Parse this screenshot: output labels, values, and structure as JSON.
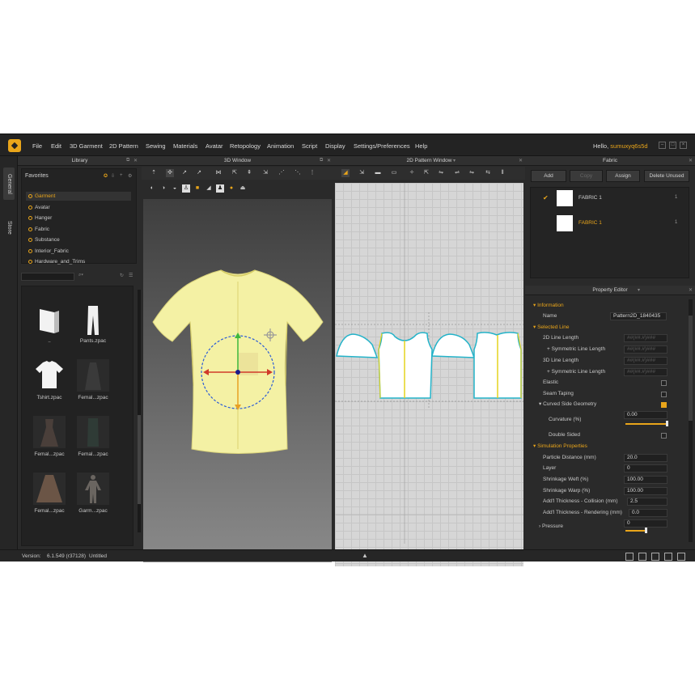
{
  "menu": [
    "File",
    "Edit",
    "3D Garment",
    "2D Pattern",
    "Sewing",
    "Materials",
    "Avatar",
    "Retopology",
    "Animation",
    "Script",
    "Display",
    "Settings/Preferences",
    "Help"
  ],
  "greeting": {
    "prefix": "Hello,",
    "user": "sumuxyq6s5d"
  },
  "window_controls": [
    "minimize",
    "restore",
    "close"
  ],
  "side_tabs": [
    "General",
    "Store"
  ],
  "library": {
    "title": "Library",
    "favorites_title": "Favorites",
    "favorites": [
      "Garment",
      "Avatar",
      "Hanger",
      "Fabric",
      "Substance",
      "Interior_Fabric",
      "Hardware_and_Trims"
    ],
    "items": [
      {
        "label": "..",
        "icon": "folder-up-icon"
      },
      {
        "label": "Pants.zpac",
        "icon": "pants-icon"
      },
      {
        "label": "Tshirt.zpac",
        "icon": "tshirt-icon"
      },
      {
        "label": "Femal...zpac",
        "icon": "dress-icon"
      },
      {
        "label": "Femal...zpac",
        "icon": "dress-icon"
      },
      {
        "label": "Femal...zpac",
        "icon": "dress-icon"
      },
      {
        "label": "Femal...zpac",
        "icon": "skirt-icon"
      },
      {
        "label": "Garm...zpac",
        "icon": "avatar-icon"
      }
    ]
  },
  "window3d": {
    "title": "3D Window"
  },
  "window2d": {
    "title": "2D Pattern Window"
  },
  "fabric": {
    "title": "Fabric",
    "buttons": [
      "Add",
      "Copy",
      "Assign",
      "Delete Unused"
    ],
    "items": [
      {
        "name": "FABRIC 1",
        "count": "1"
      },
      {
        "name": "FABRIC 1",
        "count": "1"
      }
    ]
  },
  "property_editor": {
    "title": "Property Editor",
    "information_label": "Information",
    "name_label": "Name",
    "name_value": "Pattern2D_1840435",
    "selected_line_label": "Selected Line",
    "line_2d_length": "2D Line Length",
    "symmetric_2d": "+ Symmetric Line Length",
    "line_3d_length": "3D Line Length",
    "symmetric_3d": "+ Symmetric Line Length",
    "dim_value": "##(##.#)###",
    "elastic_label": "Elastic",
    "seam_taping_label": "Seam Taping",
    "curved_side_label": "Curved Side Geometry",
    "curvature_label": "Curvature (%)",
    "curvature_value": "0.00",
    "curvature_fraction": 1.0,
    "double_sided_label": "Double Sided",
    "simulation_label": "Simulation Properties",
    "particle_distance_label": "Particle Distance (mm)",
    "particle_distance_value": "20.0",
    "layer_label": "Layer",
    "layer_value": "0",
    "shrinkage_weft_label": "Shrinkage Weft (%)",
    "shrinkage_weft_value": "100.00",
    "shrinkage_warp_label": "Shrinkage Warp (%)",
    "shrinkage_warp_value": "100.00",
    "thickness_collision_label": "Add'l Thickness - Collision (mm)",
    "thickness_collision_value": "2.5",
    "thickness_rendering_label": "Add'l Thickness - Rendering (mm)",
    "thickness_rendering_value": "0.0",
    "pressure_label": "Pressure",
    "pressure_value": "0",
    "pressure_fraction": 0.0
  },
  "status": {
    "version_label": "Version:",
    "version_value": "6.1.549 (r37128)",
    "file_name": "Untitled"
  },
  "colors": {
    "accent": "#e9a51a",
    "garment": "#f4f1a4",
    "selection_blue": "#2a5bd7"
  }
}
